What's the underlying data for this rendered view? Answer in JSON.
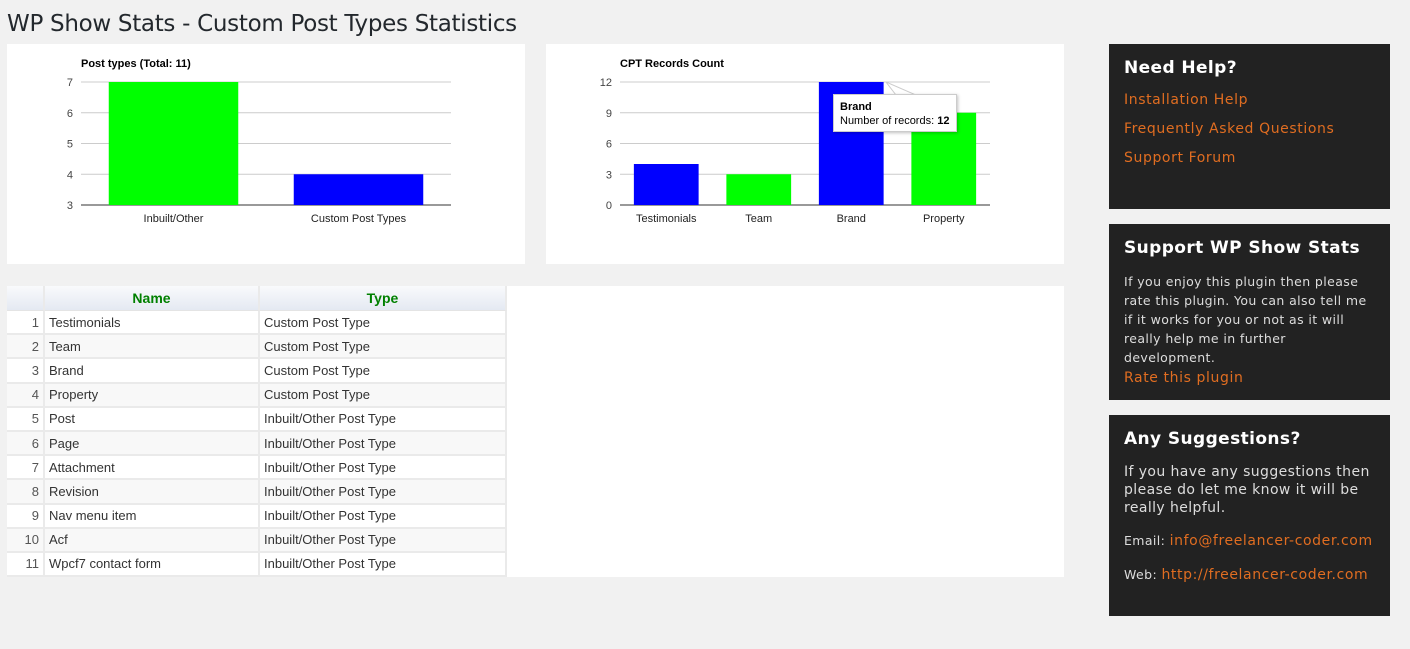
{
  "page": {
    "title": "WP Show Stats - Custom Post Types Statistics"
  },
  "chart_data": [
    {
      "type": "bar",
      "title": "Post types (Total: 11)",
      "categories": [
        "Inbuilt/Other",
        "Custom Post Types"
      ],
      "values": [
        7,
        4
      ],
      "colors": [
        "#00ff00",
        "#0000ff"
      ],
      "xlabel": "",
      "ylabel": "",
      "ylim": [
        3,
        7
      ],
      "yticks": [
        3,
        4,
        5,
        6,
        7
      ],
      "grid": true,
      "legend": "none"
    },
    {
      "type": "bar",
      "title": "CPT Records Count",
      "categories": [
        "Testimonials",
        "Team",
        "Brand",
        "Property"
      ],
      "values": [
        4,
        3,
        12,
        9
      ],
      "colors": [
        "#0000ff",
        "#00ff00",
        "#0000ff",
        "#00ff00"
      ],
      "xlabel": "",
      "ylabel": "",
      "ylim": [
        0,
        12
      ],
      "yticks": [
        0,
        3,
        6,
        9,
        12
      ],
      "grid": true,
      "legend": "none",
      "tooltip": {
        "title": "Brand",
        "label": "Number of records:",
        "value": "12"
      }
    }
  ],
  "table": {
    "headers": [
      "",
      "Name",
      "Type"
    ],
    "rows": [
      {
        "index": "1",
        "name": "Testimonials",
        "type": "Custom Post Type"
      },
      {
        "index": "2",
        "name": "Team",
        "type": "Custom Post Type"
      },
      {
        "index": "3",
        "name": "Brand",
        "type": "Custom Post Type"
      },
      {
        "index": "4",
        "name": "Property",
        "type": "Custom Post Type"
      },
      {
        "index": "5",
        "name": "Post",
        "type": "Inbuilt/Other Post Type"
      },
      {
        "index": "6",
        "name": "Page",
        "type": "Inbuilt/Other Post Type"
      },
      {
        "index": "7",
        "name": "Attachment",
        "type": "Inbuilt/Other Post Type"
      },
      {
        "index": "8",
        "name": "Revision",
        "type": "Inbuilt/Other Post Type"
      },
      {
        "index": "9",
        "name": "Nav menu item",
        "type": "Inbuilt/Other Post Type"
      },
      {
        "index": "10",
        "name": "Acf",
        "type": "Inbuilt/Other Post Type"
      },
      {
        "index": "11",
        "name": "Wpcf7 contact form",
        "type": "Inbuilt/Other Post Type"
      }
    ]
  },
  "sidebar": {
    "help": {
      "title": "Need Help?",
      "links": [
        "Installation Help",
        "Frequently Asked Questions",
        "Support Forum"
      ]
    },
    "support": {
      "title": "Support WP Show Stats",
      "text": "If you enjoy this plugin then please rate this plugin. You can also tell me if it works for you or not as it will really help me in further development.",
      "link": "Rate this plugin"
    },
    "suggestions": {
      "title": "Any Suggestions?",
      "text": "If you have any suggestions then please do let me know it will be really helpful.",
      "email_label": "Email:",
      "email": "info@freelancer-coder.com",
      "web_label": "Web:",
      "web": "http://freelancer-coder.com"
    }
  },
  "colors": {
    "accent_link": "#e06d21",
    "widget_bg": "#222222",
    "table_header_text": "#008000",
    "bar_green": "#00ff00",
    "bar_blue": "#0000ff"
  }
}
